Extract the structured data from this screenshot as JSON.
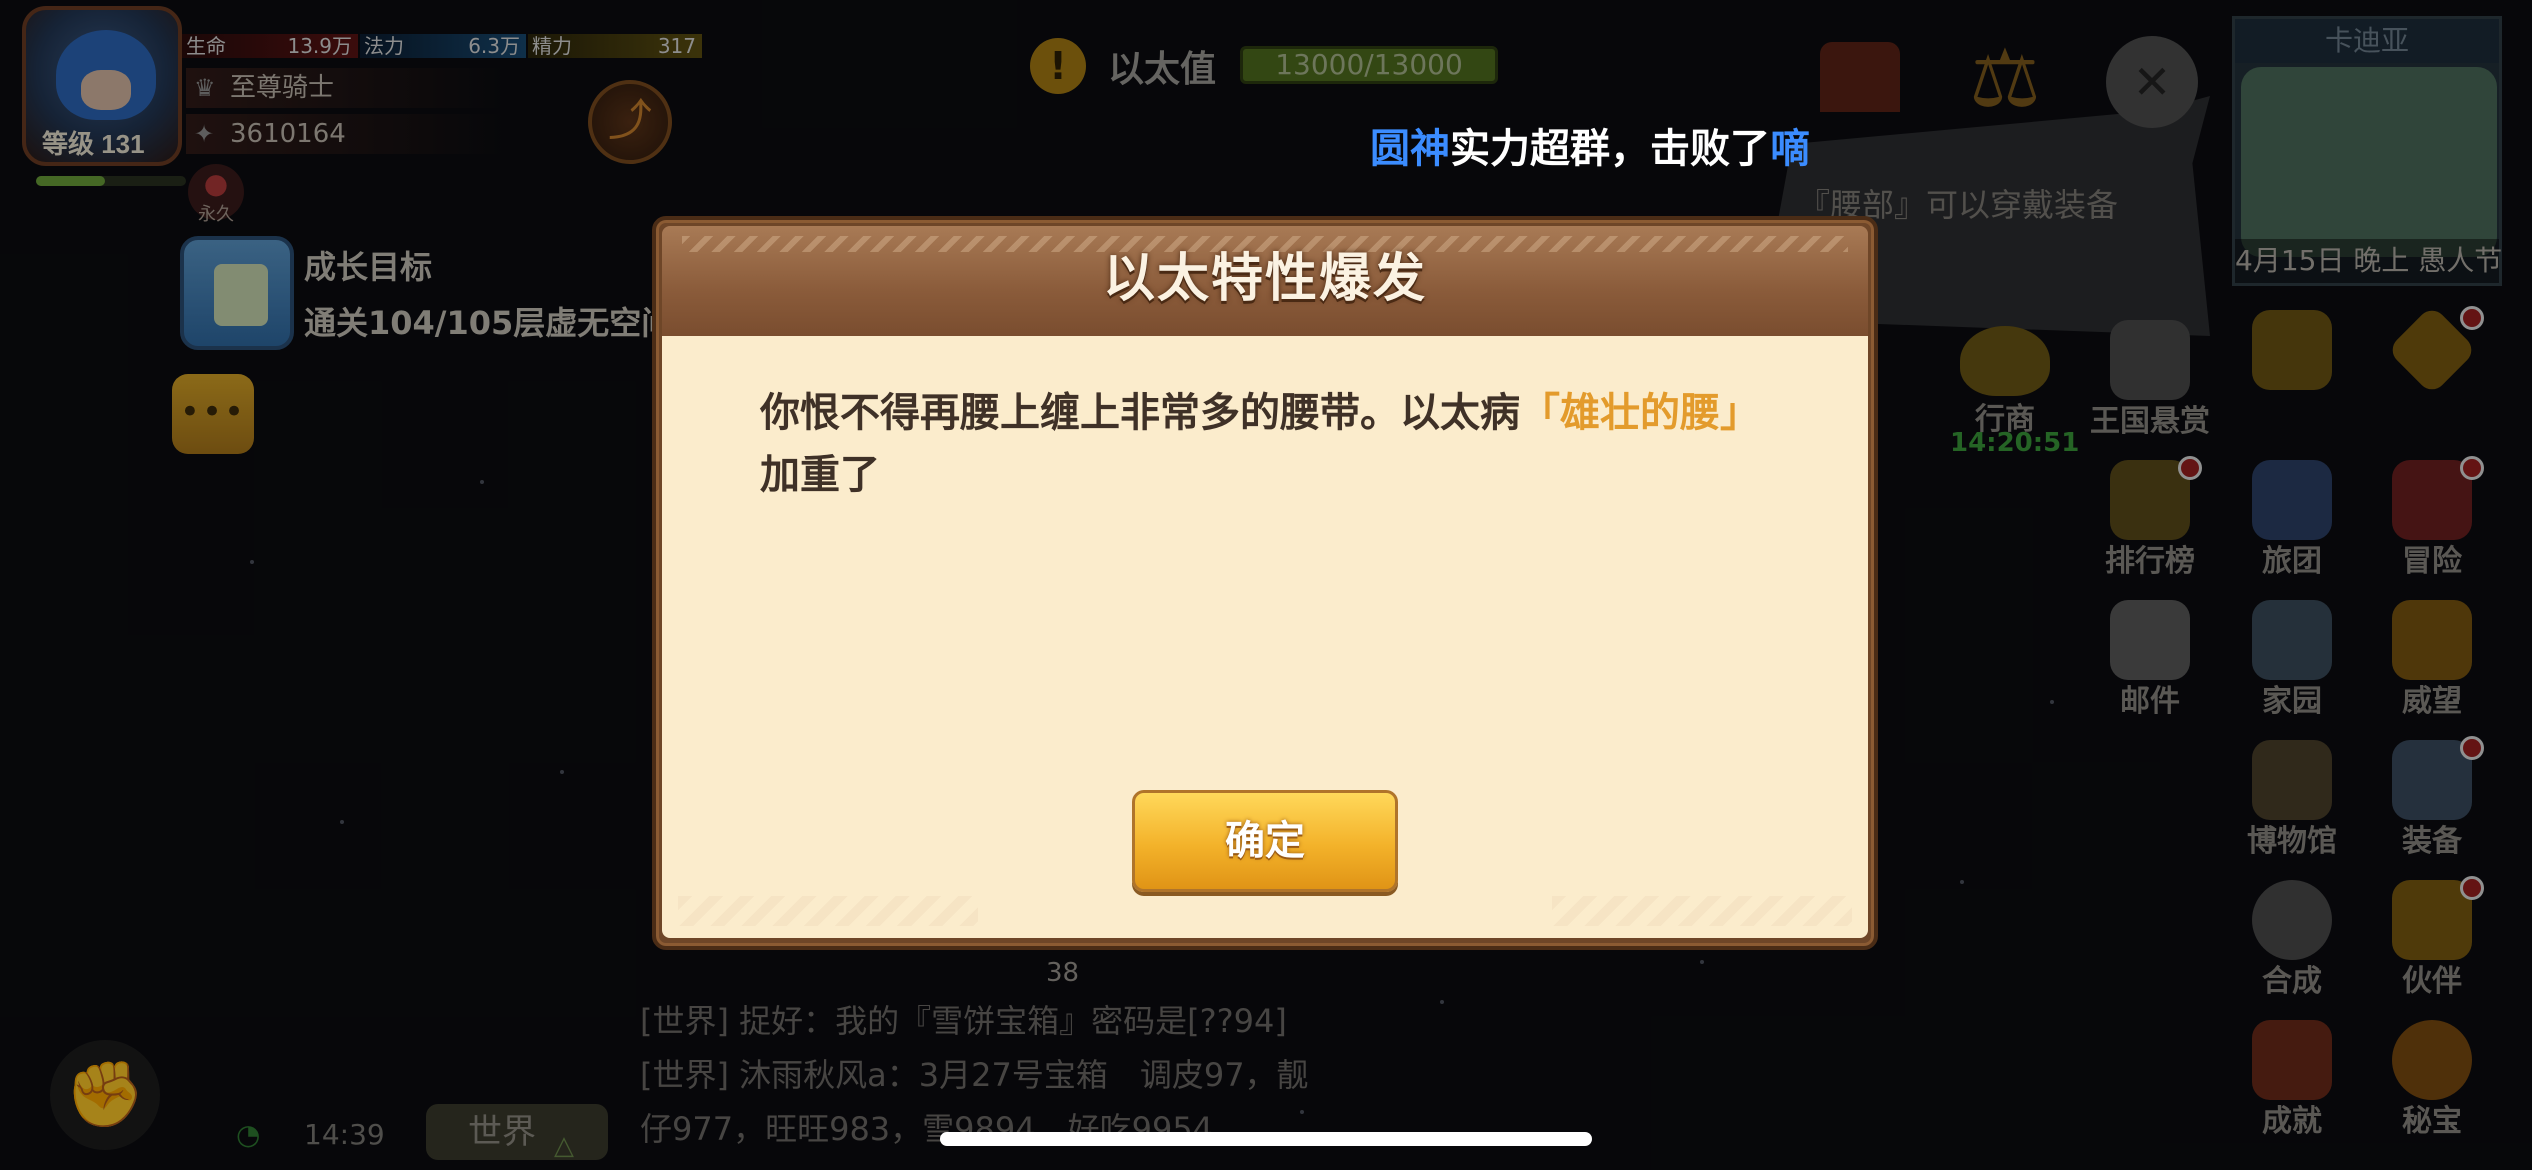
{
  "player": {
    "level": "等级 131",
    "hp_label": "生命",
    "hp_value": "13.9万",
    "mp_label": "法力",
    "mp_value": "6.3万",
    "sp_label": "精力",
    "sp_value": "317",
    "xp_progress_percent": 46,
    "title": "至尊骑士",
    "power": "3610164",
    "badge_label": "永久"
  },
  "growth_goal": {
    "title": "成长目标",
    "desc": "通关104/105层虚无空间"
  },
  "more_button": "•••",
  "ether": {
    "icon": "!",
    "label": "以太值",
    "value": "13000/13000"
  },
  "toast": {
    "name1": "圆神",
    "middle": "实力超群，击败了",
    "name2": "嘀"
  },
  "tip": "『腰部』可以穿戴装备",
  "minimap": {
    "name": "卡迪亚",
    "date": "4月15日 晚上 愚人节"
  },
  "right_icons": {
    "merchant": "行商",
    "merchant_timer": "14:20:51",
    "bounty": "王国悬赏",
    "ranking": "排行榜",
    "guild": "旅团",
    "adventure": "冒险",
    "mail": "邮件",
    "home": "家园",
    "prestige": "威望",
    "museum": "博物馆",
    "equipment": "装备",
    "synthesis": "合成",
    "partner": "伙伴",
    "achievement": "成就",
    "secret": "秘宝"
  },
  "chat": {
    "count": "38",
    "lines": [
      "[世界] 捉好：我的『雪饼宝箱』密码是[??94]",
      "[世界] 沐雨秋风a：3月27号宝箱　调皮97，靓",
      "仔977，旺旺983，雪9894，好吃9954"
    ],
    "channel_button": "世界",
    "time": "14:39"
  },
  "dialog": {
    "title": "以太特性爆发",
    "msg_part1": "你恨不得再腰上缠上非常多的腰带。以太病",
    "msg_highlight": "「雄壮的腰」",
    "msg_part2": "加重了",
    "confirm": "确定"
  },
  "colors": {
    "dialog_body": "#fbeccc",
    "dialog_header": "#8a5b3a",
    "highlight": "#e39b2c",
    "confirm_button": "#f3b22a",
    "toast_name": "#3b8cff"
  }
}
